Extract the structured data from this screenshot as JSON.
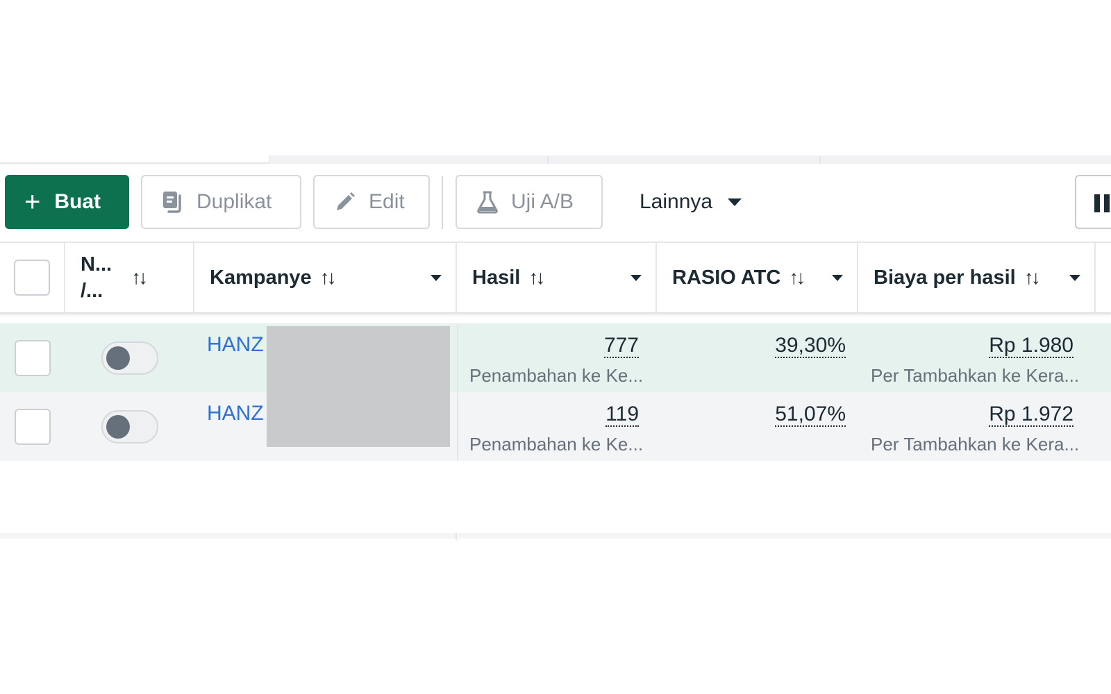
{
  "toolbar": {
    "create_label": "Buat",
    "duplicate_label": "Duplikat",
    "edit_label": "Edit",
    "ab_test_label": "Uji A/B",
    "more_label": "Lainnya"
  },
  "table": {
    "headers": {
      "name_line1": "N...",
      "name_line2": "/...",
      "campaign": "Kampanye",
      "results": "Hasil",
      "atc_ratio": "RASIO ATC",
      "cost_per_result": "Biaya per hasil"
    },
    "sort_glyph": "↑↓",
    "rows": [
      {
        "campaign": "HANZ",
        "results": "777",
        "results_sub": "Penambahan ke Ke...",
        "atc_ratio": "39,30%",
        "cost": "Rp 1.980",
        "cost_sub": "Per Tambahkan ke Kera..."
      },
      {
        "campaign": "HANZ",
        "results": "119",
        "results_sub": "Penambahan ke Ke...",
        "atc_ratio": "51,07%",
        "cost": "Rp 1.972",
        "cost_sub": "Per Tambahkan ke Kera..."
      }
    ]
  },
  "colors": {
    "primary": "#0d7150",
    "link": "#2f6fd6",
    "selected_row": "#e6f2ee",
    "row": "#f3f4f6"
  },
  "icons": [
    "plus-icon",
    "duplicate-icon",
    "pencil-icon",
    "flask-icon",
    "caret-down-icon",
    "columns-icon",
    "sort-icon"
  ]
}
